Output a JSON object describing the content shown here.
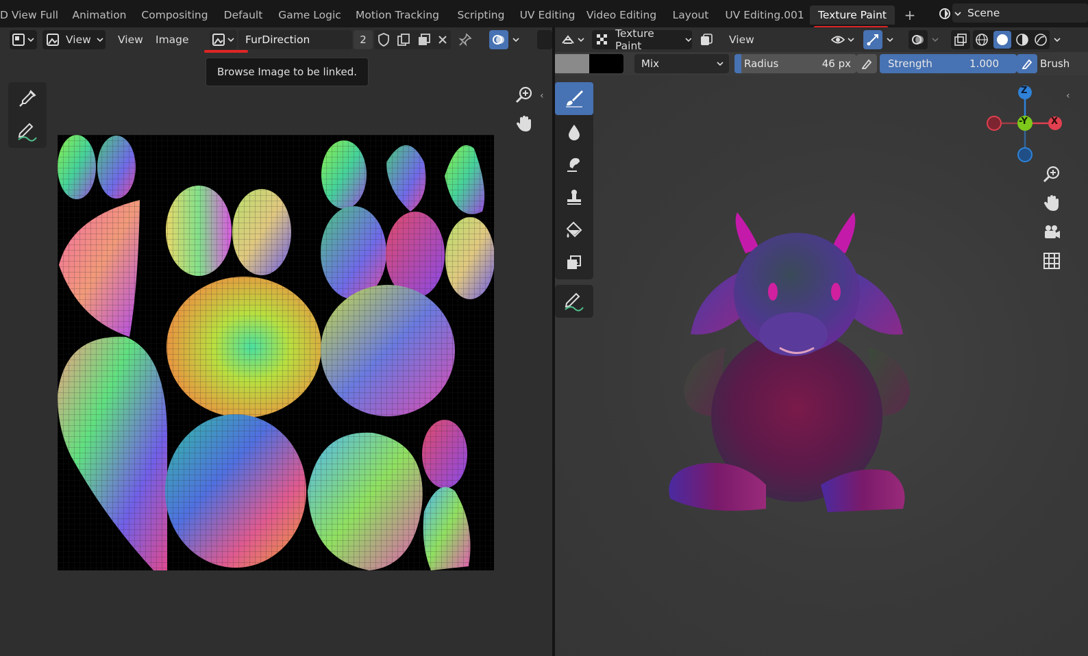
{
  "workspace_tabs": [
    {
      "label": "D View Full"
    },
    {
      "label": "Animation"
    },
    {
      "label": "Compositing"
    },
    {
      "label": "Default"
    },
    {
      "label": "Game Logic"
    },
    {
      "label": "Motion Tracking"
    },
    {
      "label": "Scripting"
    },
    {
      "label": "UV Editing"
    },
    {
      "label": "Video Editing"
    },
    {
      "label": "Layout"
    },
    {
      "label": "UV Editing.001"
    },
    {
      "label": "Texture Paint",
      "active": true
    }
  ],
  "add_workspace": "+",
  "scene": {
    "label": "Scene"
  },
  "image_editor": {
    "view_mode": "View",
    "menus": [
      "View",
      "Image"
    ],
    "image_name": "FurDirection",
    "user_count": "2",
    "tooltip": "Browse Image to be linked."
  },
  "viewport": {
    "mode": "Texture Paint",
    "menu": "View",
    "blend_mode": "Mix",
    "radius_label": "Radius",
    "radius_value": "46 px",
    "strength_label": "Strength",
    "strength_value": "1.000",
    "strength_fraction": 1.0,
    "brush_label": "Brush",
    "gizmo": {
      "z": "Z",
      "y": "-Y",
      "x": "X"
    }
  },
  "colors": {
    "accent_blue": "#4772b3",
    "highlight_red": "#e02424",
    "axis_x": "#e0404f",
    "axis_y": "#7ec81c",
    "axis_z": "#2f82d8"
  },
  "icons": [
    "editor-type-icon",
    "image-icon",
    "eyedropper-icon",
    "annotate-icon",
    "zoom-icon",
    "hand-icon",
    "fake-user-icon",
    "new-image-icon",
    "open-image-icon",
    "close-icon",
    "pin-icon",
    "overlay-icon",
    "paint-brush-icon",
    "blur-icon",
    "smear-icon",
    "clone-icon",
    "fill-icon",
    "mask-icon",
    "camera-icon",
    "grid-icon"
  ]
}
